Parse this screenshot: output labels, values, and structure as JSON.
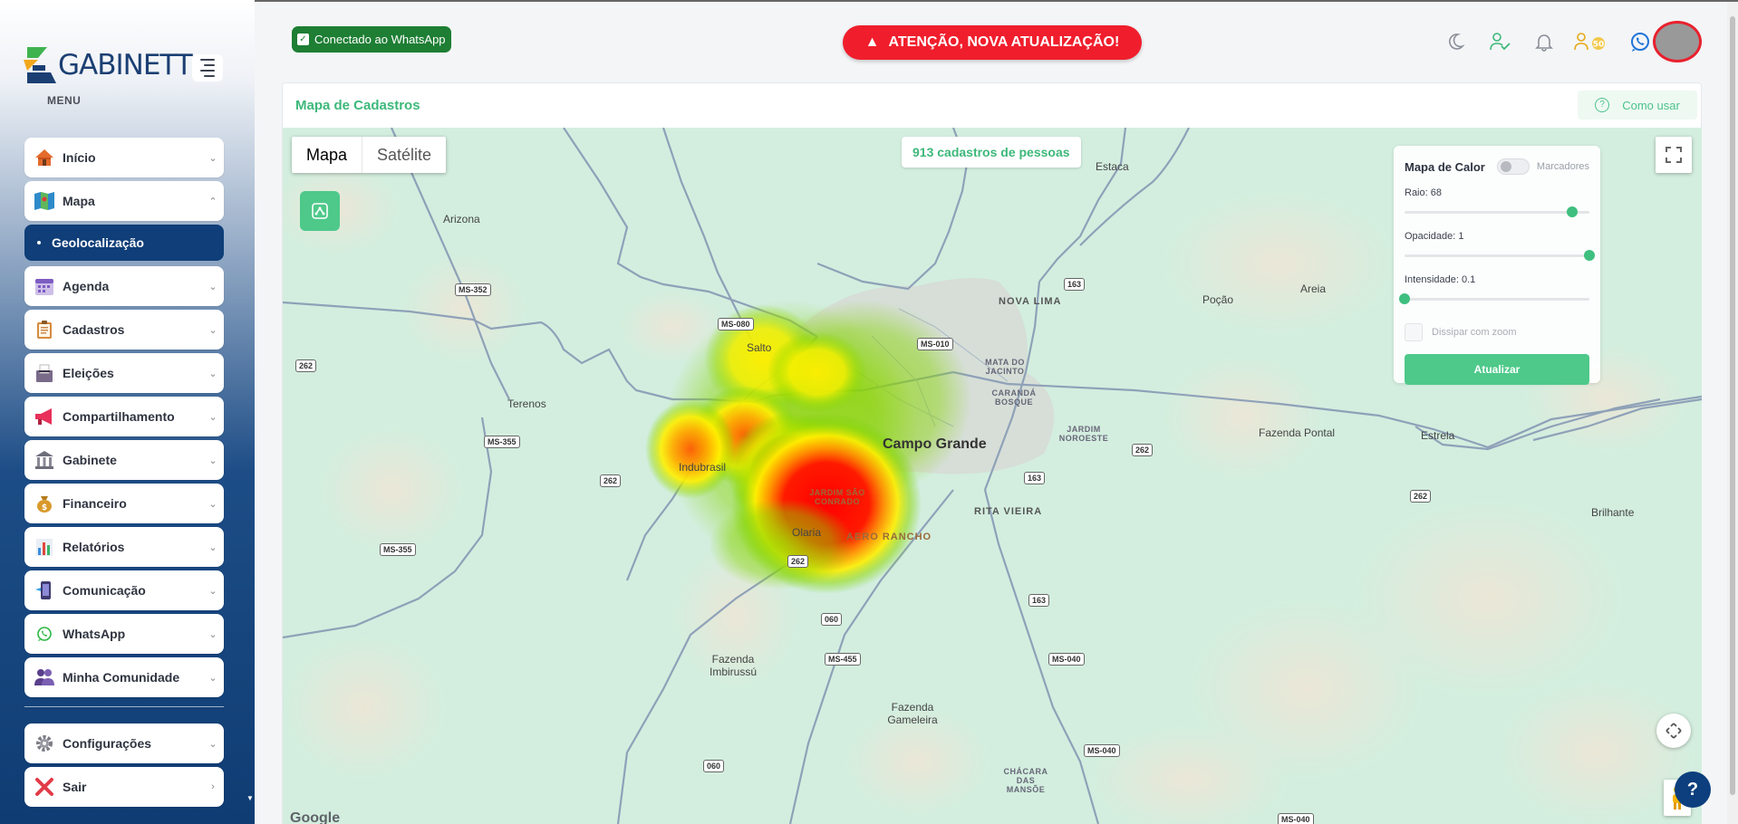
{
  "app": {
    "logo_text": "GABINETT",
    "menu_title": "MENU"
  },
  "sidebar": {
    "items": [
      {
        "label": "Início",
        "icon": "house-icon",
        "expanded": false
      },
      {
        "label": "Mapa",
        "icon": "map-icon",
        "expanded": true
      },
      {
        "label": "Agenda",
        "icon": "calendar-icon",
        "expanded": false
      },
      {
        "label": "Cadastros",
        "icon": "clipboard-icon",
        "expanded": false
      },
      {
        "label": "Eleições",
        "icon": "ballot-box-icon",
        "expanded": false
      },
      {
        "label": "Compartilhamento",
        "icon": "megaphone-icon",
        "expanded": false
      },
      {
        "label": "Gabinete",
        "icon": "bank-icon",
        "expanded": false
      },
      {
        "label": "Financeiro",
        "icon": "money-bag-icon",
        "expanded": false
      },
      {
        "label": "Relatórios",
        "icon": "bar-chart-icon",
        "expanded": false
      },
      {
        "label": "Comunicação",
        "icon": "phone-icon",
        "expanded": false
      },
      {
        "label": "WhatsApp",
        "icon": "whatsapp-icon",
        "expanded": false
      },
      {
        "label": "Minha Comunidade",
        "icon": "people-icon",
        "expanded": false
      }
    ],
    "submenu_active": "Geolocalização",
    "bottom_items": [
      {
        "label": "Configurações",
        "icon": "gear-icon"
      },
      {
        "label": "Sair",
        "icon": "x-icon"
      }
    ]
  },
  "topbar": {
    "whatsapp_status": "Conectado ao WhatsApp",
    "alert": "ATENÇÃO, NOVA ATUALIZAÇÃO!",
    "badge_count": "50",
    "icons": [
      "moon-icon",
      "user-check-icon",
      "bell-icon",
      "users-badge-icon",
      "whatsapp-icon"
    ]
  },
  "page": {
    "title": "Mapa de Cadastros",
    "help_button": "Como usar"
  },
  "map": {
    "type_options": [
      "Mapa",
      "Satélite"
    ],
    "active_type": "Mapa",
    "count_text": "913 cadastros de pessoas",
    "google_label": "Google",
    "heatmap": {
      "title": "Mapa de Calor",
      "markers_label": "Marcadores",
      "markers_on": false,
      "radius_label": "Raio: 68",
      "radius": 68,
      "radius_max": 75,
      "opacity_label": "Opacidade: 1",
      "opacity": 1,
      "intensity_label": "Intensidade: 0.1",
      "intensity": 0.1,
      "dissipate_label": "Dissipar com zoom",
      "dissipate": false,
      "update_button": "Atualizar"
    },
    "places": {
      "campo_grande": "Campo Grande",
      "arizona": "Arizona",
      "terenos": "Terenos",
      "salto": "Salto",
      "indubrasil": "Indubrasil",
      "olaria": "Olaria",
      "estaca": "Estaca",
      "pocao": "Poção",
      "areia": "Areia",
      "fazenda_pontal": "Fazenda Pontal",
      "estrela": "Estrela",
      "brilhante": "Brilhante",
      "fazenda_imbirussu": "Fazenda Imbirussú",
      "fazenda_gameleira": "Fazenda Gameleira",
      "nova_lima": "NOVA LIMA",
      "mata_do_jacinto": "MATA DO JACINTO",
      "caranda_bosque": "CARANDÁ BOSQUE",
      "jardim_noroeste": "JARDIM NOROESTE",
      "rita_vieira": "RITA VIEIRA",
      "aero_rancho": "AERO RANCHO",
      "jardim_sao_conrado": "JARDIM SÃO CONRADO",
      "chacara_das_mansoes": "CHÁCARA DAS MANSÕE"
    },
    "shields": [
      "MS-352",
      "MS-080",
      "MS-010",
      "163",
      "262",
      "MS-355",
      "262",
      "MS-355",
      "262",
      "262",
      "163",
      "262",
      "163",
      "060",
      "MS-455",
      "MS-040",
      "060",
      "MS-040",
      "MS-040"
    ]
  }
}
